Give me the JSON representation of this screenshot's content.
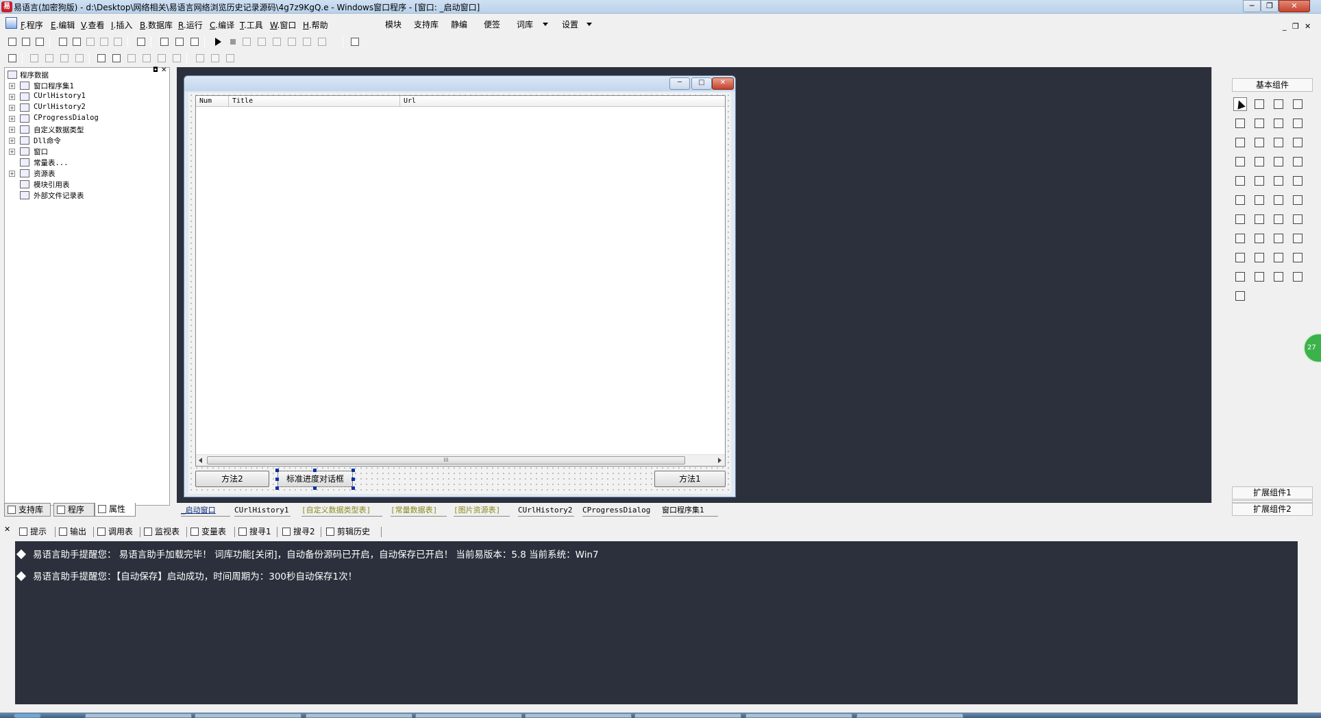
{
  "window": {
    "title": "易语言(加密狗版) - d:\\Desktop\\网络相关\\易语言网络浏览历史记录源码\\4g7z9KgQ.e - Windows窗口程序 - [窗口: _启动窗口]",
    "minimize": "─",
    "restore": "❐",
    "close": "✕"
  },
  "menu": {
    "items": [
      {
        "key": "F",
        "label": ".程序"
      },
      {
        "key": "E",
        "label": ".编辑"
      },
      {
        "key": "V",
        "label": ".查看"
      },
      {
        "key": "I",
        "label": ".插入"
      },
      {
        "key": "B",
        "label": ".数据库"
      },
      {
        "key": "R",
        "label": ".运行"
      },
      {
        "key": "C",
        "label": ".编译"
      },
      {
        "key": "T",
        "label": ".工具"
      },
      {
        "key": "W",
        "label": ".窗口"
      },
      {
        "key": "H",
        "label": ".帮助"
      }
    ],
    "extra": [
      "模块",
      "支持库",
      "静编",
      "便签",
      "词库",
      "设置"
    ]
  },
  "tree": {
    "root": "程序数据",
    "items": [
      {
        "label": "窗口程序集1",
        "expander": "+"
      },
      {
        "label": "CUrlHistory1",
        "expander": "+"
      },
      {
        "label": "CUrlHistory2",
        "expander": "+"
      },
      {
        "label": "CProgressDialog",
        "expander": "+"
      },
      {
        "label": "自定义数据类型",
        "expander": "+"
      },
      {
        "label": "Dll命令",
        "expander": "+"
      },
      {
        "label": "窗口",
        "expander": "+"
      },
      {
        "label": "常量表...",
        "expander": ""
      },
      {
        "label": "资源表",
        "expander": "+"
      },
      {
        "label": "模块引用表",
        "expander": ""
      },
      {
        "label": "外部文件记录表",
        "expander": ""
      }
    ]
  },
  "left_tabs": [
    "支持库",
    "程序",
    "属性"
  ],
  "form": {
    "min": "─",
    "max": "□",
    "close": "✕",
    "columns": [
      "Num",
      "Title",
      "Url"
    ],
    "scroll_grip": "III",
    "buttons": [
      "方法2",
      "标准进度对话框",
      "方法1"
    ]
  },
  "palette": {
    "header": "基本组件",
    "footer1": "扩展组件1",
    "footer2": "扩展组件2"
  },
  "doc_tabs": [
    {
      "label": "_启动窗口",
      "style": "active"
    },
    {
      "label": "CUrlHistory1",
      "style": "normal"
    },
    {
      "label": "[自定义数据类型表]",
      "style": "olive"
    },
    {
      "label": "[常量数据表]",
      "style": "olive"
    },
    {
      "label": "[图片资源表]",
      "style": "olive"
    },
    {
      "label": "CUrlHistory2",
      "style": "normal"
    },
    {
      "label": "CProgressDialog",
      "style": "normal"
    },
    {
      "label": "窗口程序集1",
      "style": "normal"
    }
  ],
  "output_tabs": [
    "提示",
    "输出",
    "调用表",
    "监视表",
    "变量表",
    "搜寻1",
    "搜寻2",
    "剪辑历史"
  ],
  "output_lines": [
    "易语言助手提醒您：  易语言助手加载完毕！  词库功能[关闭]，自动备份源码已开启，自动保存已开启！  当前易版本：5.8  当前系统：Win7",
    "易语言助手提醒您：【自动保存】启动成功，时间周期为：300秒自动保存1次！"
  ],
  "side_badge": "27",
  "colors": {
    "designer_bg": "#2b303c",
    "output_bg": "#2b303c",
    "title_bar": "#c2d6ee"
  }
}
